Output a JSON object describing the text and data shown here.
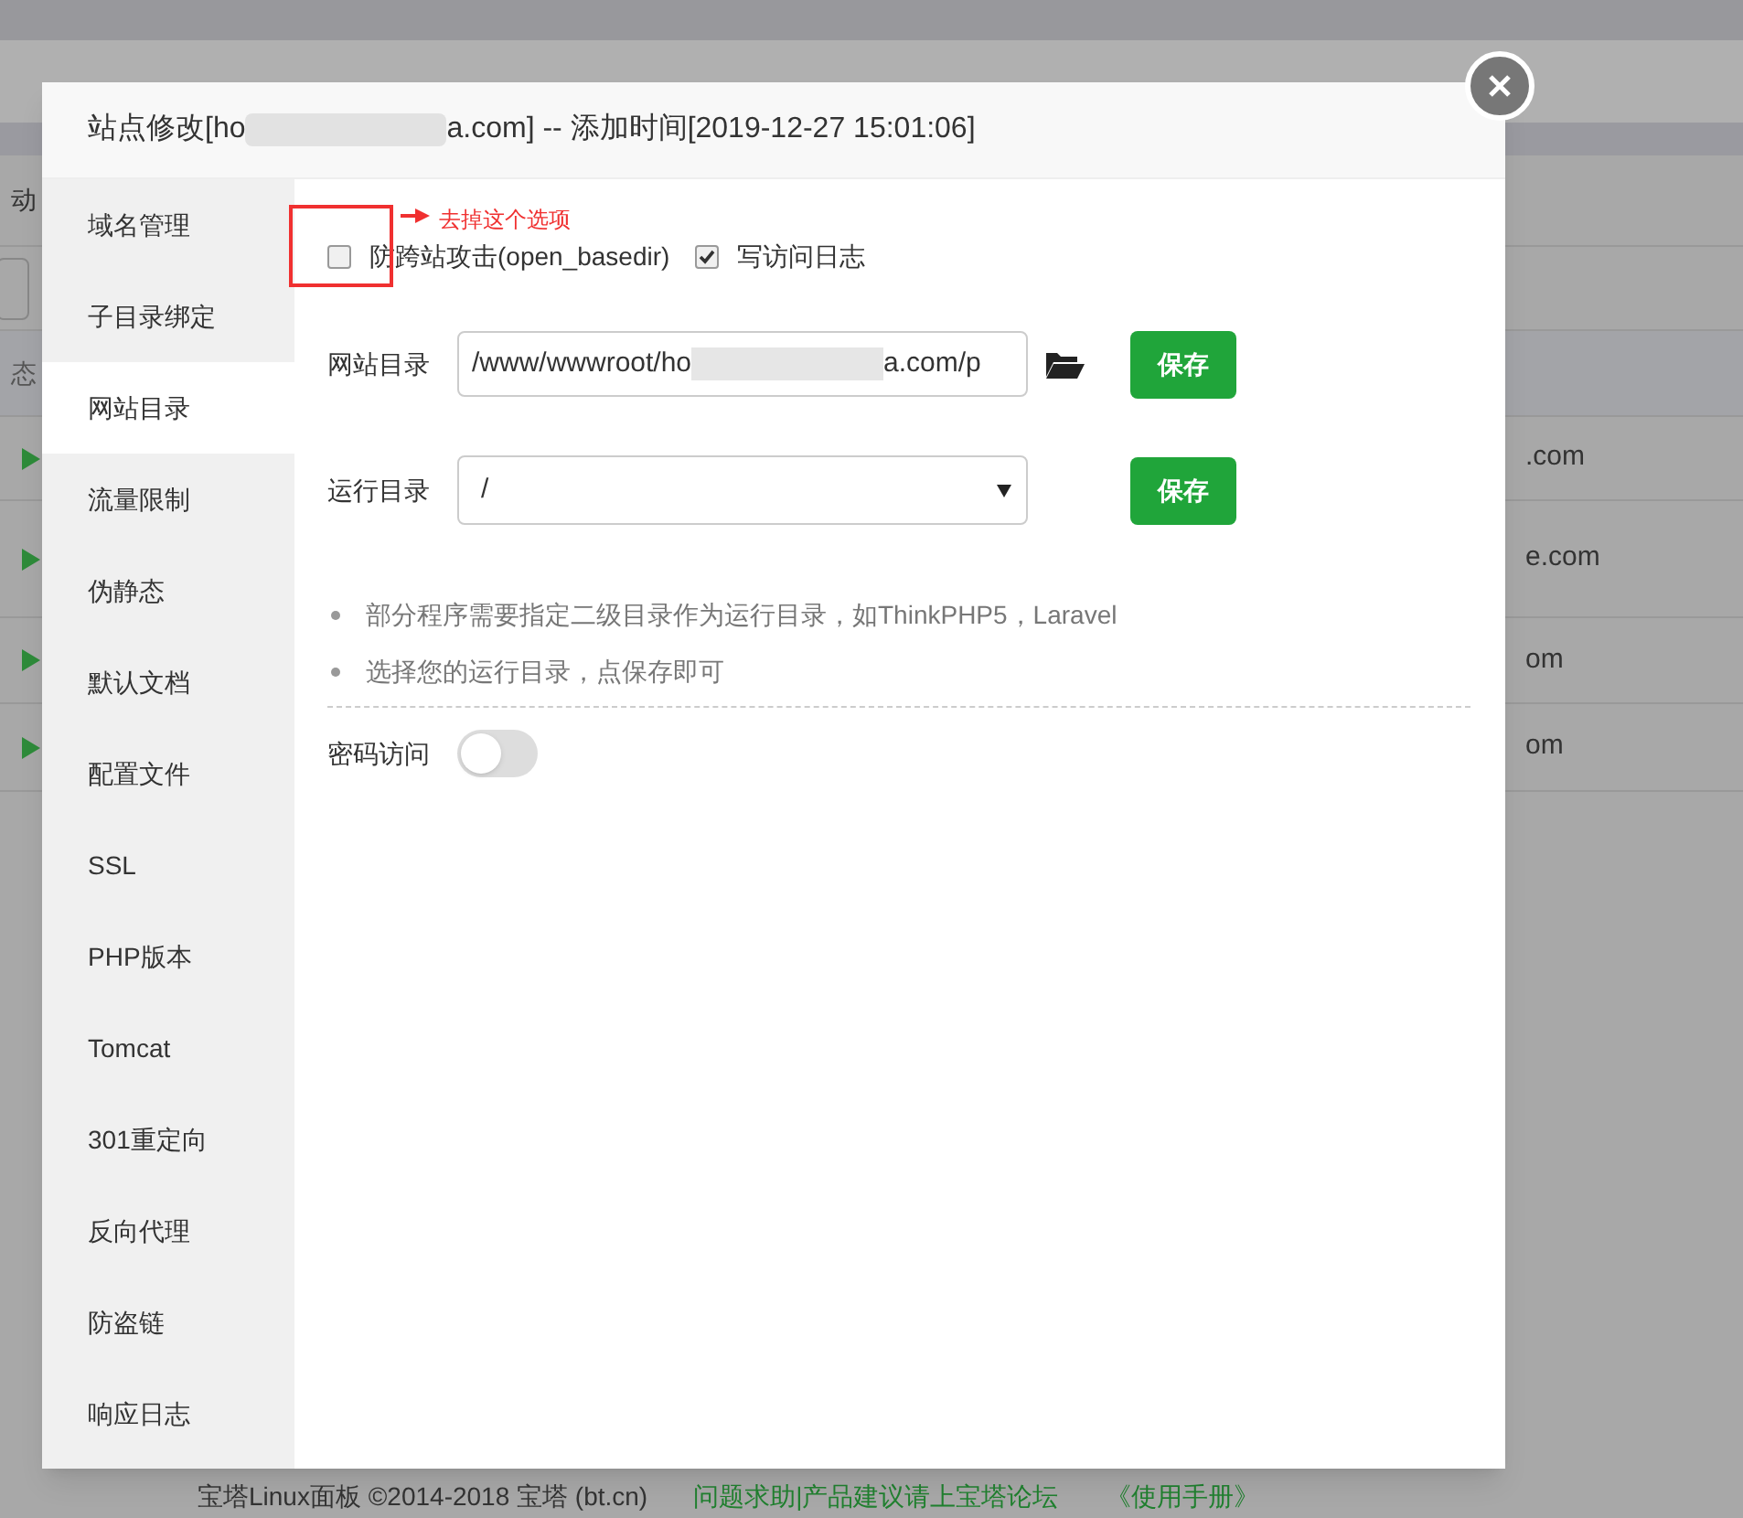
{
  "background": {
    "left_texts": [
      "动",
      "态"
    ],
    "rows": [
      {
        "domain": ".com"
      },
      {
        "domain": "e.com"
      },
      {
        "domain": "om"
      },
      {
        "domain": "om"
      }
    ],
    "footer": {
      "copyright": "宝塔Linux面板 ©2014-2018 宝塔 (bt.cn)",
      "forum_link": "问题求助|产品建议请上宝塔论坛",
      "manual_link": "《使用手册》"
    }
  },
  "dialog": {
    "title_start": "站点修改[ho",
    "title_end": "a.com] -- 添加时间[2019-12-27 15:01:06]",
    "sidebar": [
      {
        "label": "域名管理",
        "selected": false
      },
      {
        "label": "子目录绑定",
        "selected": false
      },
      {
        "label": "网站目录",
        "selected": true
      },
      {
        "label": "流量限制",
        "selected": false
      },
      {
        "label": "伪静态",
        "selected": false
      },
      {
        "label": "默认文档",
        "selected": false
      },
      {
        "label": "配置文件",
        "selected": false
      },
      {
        "label": "SSL",
        "selected": false
      },
      {
        "label": "PHP版本",
        "selected": false
      },
      {
        "label": "Tomcat",
        "selected": false
      },
      {
        "label": "301重定向",
        "selected": false
      },
      {
        "label": "反向代理",
        "selected": false
      },
      {
        "label": "防盗链",
        "selected": false
      },
      {
        "label": "响应日志",
        "selected": false
      }
    ],
    "checkboxes": [
      {
        "label": "防跨站攻击(open_basedir)",
        "checked": false
      },
      {
        "label": "写访问日志",
        "checked": true
      }
    ],
    "annotation": "去掉这个选项",
    "site_dir": {
      "label": "网站目录",
      "value_start": "/www/wwwroot/ho",
      "value_end": "a.com/p",
      "button": "保存"
    },
    "run_dir": {
      "label": "运行目录",
      "value": "/",
      "button": "保存"
    },
    "tips": [
      "部分程序需要指定二级目录作为运行目录，如ThinkPHP5，Laravel",
      "选择您的运行目录，点保存即可"
    ],
    "password_access": {
      "label": "密码访问",
      "on": false
    }
  }
}
